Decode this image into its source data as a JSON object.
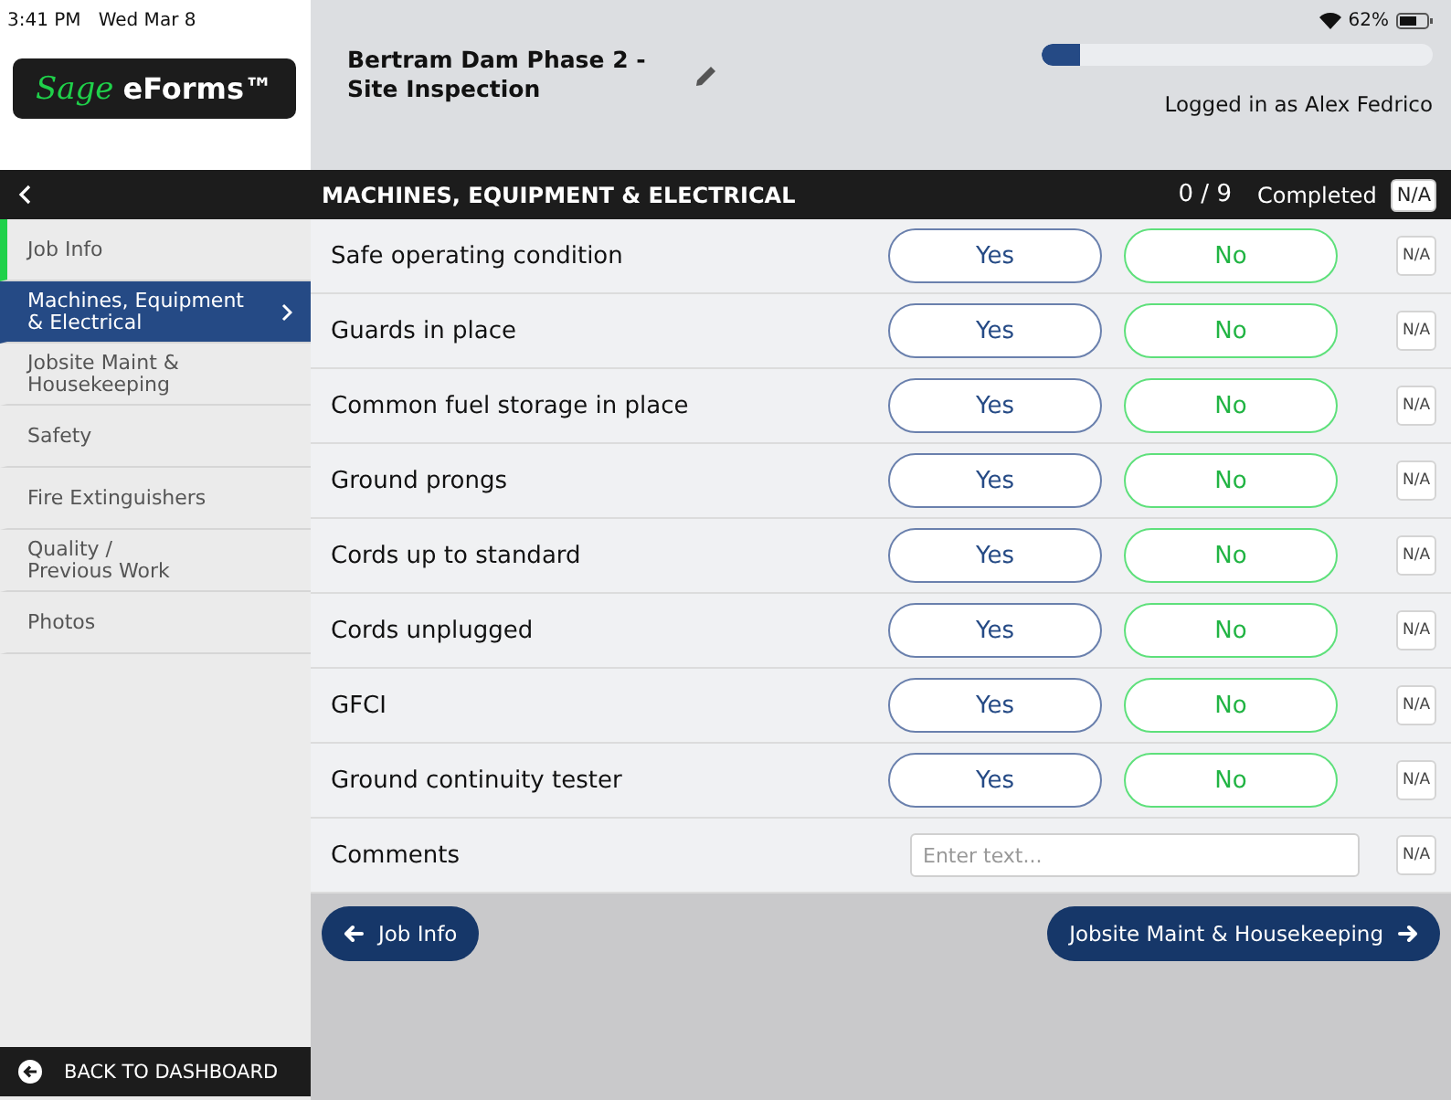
{
  "status_bar": {
    "time": "3:41 PM",
    "date": "Wed Mar 8",
    "battery": "62%"
  },
  "logo": {
    "brand": "Sage",
    "product": "eForms™"
  },
  "form": {
    "title": "Bertram Dam Phase 2 - Site Inspection",
    "progress": {
      "level": 0.1
    },
    "user": "Logged in as Alex Fedrico"
  },
  "section": {
    "title": "MACHINES, EQUIPMENT & ELECTRICAL",
    "count": "0 / 9",
    "count_label": "Completed",
    "na": "N/A"
  },
  "sidebar": {
    "items": [
      {
        "label": "Job Info",
        "selected": false,
        "complete": true
      },
      {
        "label": "Machines, Equipment\n& Electrical",
        "selected": true,
        "complete": false
      },
      {
        "label": "Jobsite Maint &\nHousekeeping",
        "selected": false,
        "complete": false
      },
      {
        "label": "Safety",
        "selected": false,
        "complete": false
      },
      {
        "label": "Fire Extinguishers",
        "selected": false,
        "complete": false
      },
      {
        "label": "Quality /\nPrevious Work",
        "selected": false,
        "complete": false
      },
      {
        "label": "Photos",
        "selected": false,
        "complete": false
      }
    ],
    "back": "BACK TO DASHBOARD"
  },
  "rows": [
    {
      "kind": "choice",
      "label": "Safe operating condition",
      "yes": {
        "label": "Yes",
        "selected": false
      },
      "no": {
        "label": "No",
        "selected": false
      },
      "na": "N/A"
    },
    {
      "kind": "choice",
      "label": "Guards in place",
      "yes": {
        "label": "Yes",
        "selected": false
      },
      "no": {
        "label": "No",
        "selected": false
      },
      "na": "N/A"
    },
    {
      "kind": "choice",
      "label": "Common fuel storage in place",
      "yes": {
        "label": "Yes",
        "selected": false
      },
      "no": {
        "label": "No",
        "selected": false
      },
      "na": "N/A"
    },
    {
      "kind": "choice",
      "label": "Ground prongs",
      "yes": {
        "label": "Yes",
        "selected": false
      },
      "no": {
        "label": "No",
        "selected": false
      },
      "na": "N/A"
    },
    {
      "kind": "choice",
      "label": "Cords up to standard",
      "yes": {
        "label": "Yes",
        "selected": false
      },
      "no": {
        "label": "No",
        "selected": false
      },
      "na": "N/A"
    },
    {
      "kind": "choice",
      "label": "Cords unplugged",
      "yes": {
        "label": "Yes",
        "selected": false
      },
      "no": {
        "label": "No",
        "selected": false
      },
      "na": "N/A"
    },
    {
      "kind": "choice",
      "label": "GFCI",
      "yes": {
        "label": "Yes",
        "selected": false
      },
      "no": {
        "label": "No",
        "selected": false
      },
      "na": "N/A"
    },
    {
      "kind": "choice",
      "label": "Ground continuity tester",
      "yes": {
        "label": "Yes",
        "selected": false
      },
      "no": {
        "label": "No",
        "selected": false
      },
      "na": "N/A"
    },
    {
      "kind": "text",
      "label": "Comments",
      "placeholder": "Enter text...",
      "na": "N/A"
    }
  ],
  "nav": {
    "prev": "Job Info",
    "next": "Jobsite Maint & Housekeeping"
  }
}
